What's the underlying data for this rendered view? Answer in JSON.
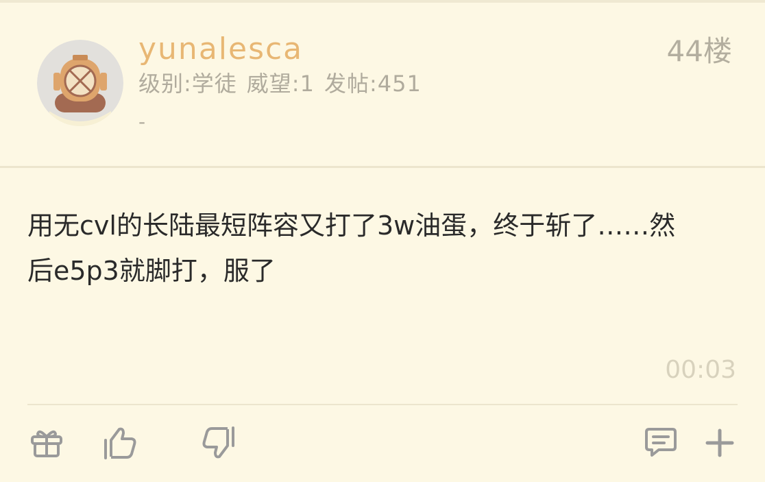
{
  "post": {
    "author": {
      "name": "yunalesca",
      "level_label": "级别:学徒",
      "prestige_label": "威望:1",
      "posts_label": "发帖:451",
      "signature": "-"
    },
    "floor": "44楼",
    "content": "用无cvl的长陆最短阵容又打了3w油蛋，终于斩了……然后e5p3就脚打，服了",
    "time": "00:03"
  },
  "actions": {
    "gift_icon": "gift-icon",
    "like_icon": "thumbs-up-icon",
    "dislike_icon": "thumbs-down-icon",
    "comment_icon": "comment-icon",
    "more_icon": "plus-icon"
  },
  "colors": {
    "background": "#fdf8e4",
    "username": "#e8b774",
    "meta": "#b0ab9d",
    "body_text": "#2a2a2a",
    "icon": "#9a9a9a"
  }
}
